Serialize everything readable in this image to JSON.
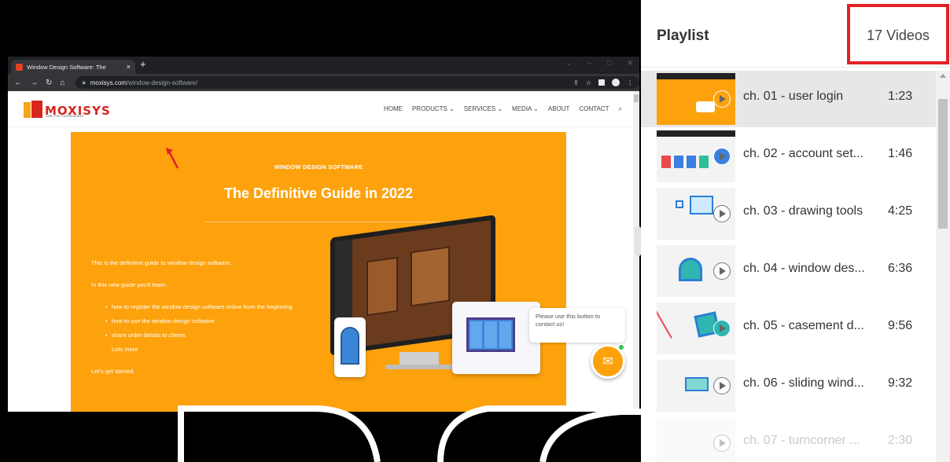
{
  "browser": {
    "tab_title": "Window Design Software: The",
    "tab_close": "×",
    "new_tab": "+",
    "url_host": "moxisys.com",
    "url_path": "/window-design-software/"
  },
  "site": {
    "logo_text": "MOXISYS",
    "logo_tagline": "CARE FOR YOUR BUSINESS",
    "nav": [
      "HOME",
      "PRODUCTS ⌄",
      "SERVICES ⌄",
      "MEDIA ⌄",
      "ABOUT",
      "CONTACT",
      "⌕"
    ],
    "eyebrow": "WINDOW DESIGN SOFTWARE",
    "title": "The Definitive Guide in 2022",
    "intro": "This is the definitive guide to window design software.",
    "learn_heading": "In this new guide you'll learn:",
    "bullets": [
      "how to register the window design software online from the beginning",
      "how to use the window design software",
      "share order details to clients"
    ],
    "more": "Lots more",
    "cta": "Let's get started.",
    "chat_text": "Please use this button to contact us!",
    "accent_color": "#fda20c"
  },
  "playlist": {
    "title": "Playlist",
    "count": "17 Videos",
    "highlight_color": "#e32127",
    "items": [
      {
        "label": "ch. 01 - user login",
        "duration": "1:23",
        "active": true
      },
      {
        "label": "ch. 02 - account set...",
        "duration": "1:46"
      },
      {
        "label": "ch. 03 - drawing tools",
        "duration": "4:25"
      },
      {
        "label": "ch. 04 - window des...",
        "duration": "6:36"
      },
      {
        "label": "ch. 05 - casement d...",
        "duration": "9:56"
      },
      {
        "label": "ch. 06 - sliding wind...",
        "duration": "9:32"
      },
      {
        "label": "ch. 07 - turncorner ...",
        "duration": "2:30"
      }
    ]
  }
}
